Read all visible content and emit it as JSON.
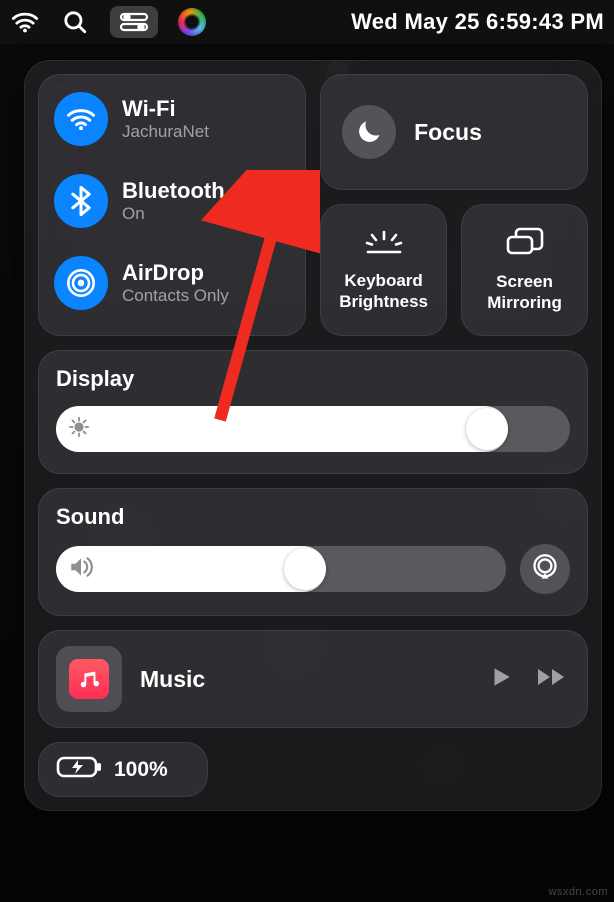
{
  "menubar": {
    "clock": "Wed May 25  6:59:43 PM"
  },
  "connectivity": {
    "wifi": {
      "title": "Wi-Fi",
      "subtitle": "JachuraNet"
    },
    "bluetooth": {
      "title": "Bluetooth",
      "subtitle": "On"
    },
    "airdrop": {
      "title": "AirDrop",
      "subtitle": "Contacts Only"
    }
  },
  "focus": {
    "title": "Focus"
  },
  "tiles": {
    "keyboard_brightness": "Keyboard Brightness",
    "screen_mirroring": "Screen Mirroring"
  },
  "display": {
    "title": "Display",
    "value_pct": 88
  },
  "sound": {
    "title": "Sound",
    "value_pct": 60
  },
  "media": {
    "title": "Music"
  },
  "battery": {
    "label": "100%"
  },
  "colors": {
    "accent": "#0a84ff",
    "arrow": "#ef2b1f"
  },
  "watermark": "wsxdn.com"
}
